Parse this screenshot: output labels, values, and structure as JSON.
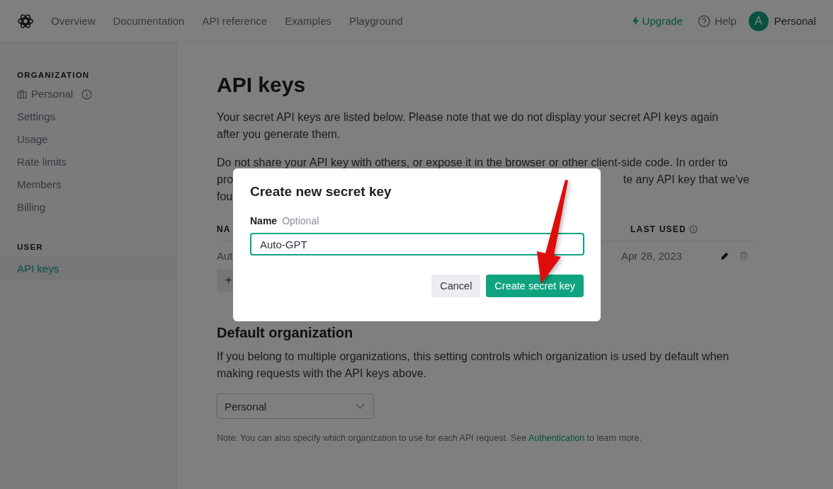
{
  "nav": {
    "links": [
      "Overview",
      "Documentation",
      "API reference",
      "Examples",
      "Playground"
    ]
  },
  "header_right": {
    "upgrade": "Upgrade",
    "help": "Help",
    "avatar": "A",
    "account": "Personal"
  },
  "sidebar": {
    "sections": [
      {
        "heading": "ORGANIZATION",
        "items": [
          {
            "label": "Personal",
            "kind": "org",
            "selected": false
          },
          {
            "label": "Settings",
            "kind": "link",
            "selected": false
          },
          {
            "label": "Usage",
            "kind": "link",
            "selected": false
          },
          {
            "label": "Rate limits",
            "kind": "link",
            "selected": false
          },
          {
            "label": "Members",
            "kind": "link",
            "selected": false
          },
          {
            "label": "Billing",
            "kind": "link",
            "selected": false
          }
        ]
      },
      {
        "heading": "USER",
        "items": [
          {
            "label": "API keys",
            "kind": "link",
            "selected": true
          }
        ]
      }
    ]
  },
  "main": {
    "title": "API keys",
    "intro": "Your secret API keys are listed below. Please note that we do not display your secret API keys again after you generate them.",
    "warning": {
      "line_1": "Do not share your API key with others, or expose it in the browser or other client-side code. In order to",
      "line_2_start": "pro",
      "line_2_end": "te any API key that we've",
      "line_3_start": "fou"
    },
    "table": {
      "columns": [
        "NA",
        "LAST USED"
      ],
      "rows": [
        {
          "name": "Aut",
          "last_used": "Apr 28, 2023"
        }
      ]
    },
    "add_button": "+",
    "default_org": {
      "heading": "Default organization",
      "text": "If you belong to multiple organizations, this setting controls which organization is used by default when making requests with the API keys above.",
      "select": "Personal",
      "note": "Note: You can also specify which organization to use for each API request. See ",
      "link": "Authentication",
      "note_end": " to learn more."
    }
  },
  "modal": {
    "title": "Create new secret key",
    "field_label": "Name",
    "field_hint": "Optional",
    "value": "Auto-GPT",
    "buttons": [
      {
        "label": "Cancel",
        "kind": "secondary"
      },
      {
        "label": "Create secret key",
        "kind": "primary"
      }
    ]
  }
}
